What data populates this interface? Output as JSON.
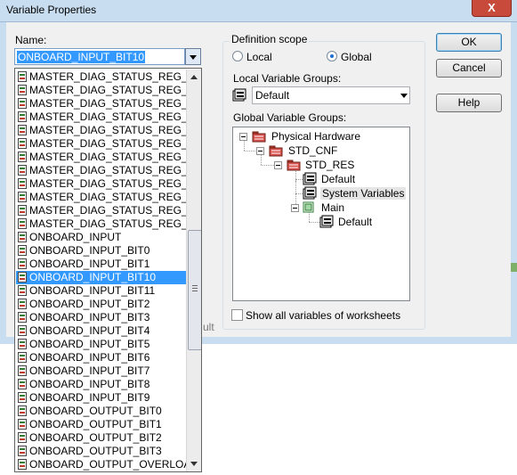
{
  "window": {
    "title": "Variable Properties",
    "close_label": "X"
  },
  "name_field": {
    "label": "Name:",
    "value": "ONBOARD_INPUT_BIT10",
    "options": [
      "MASTER_DIAG_STATUS_REG_HI",
      "MASTER_DIAG_STATUS_REG_LO",
      "MASTER_DIAG_STATUS_REG_PF",
      "MASTER_DIAG_STATUS_REG_QU",
      "MASTER_DIAG_STATUS_REG_RD",
      "MASTER_DIAG_STATUS_REG_RE",
      "MASTER_DIAG_STATUS_REG_RU",
      "MASTER_DIAG_STATUS_REG_SS",
      "MASTER_DIAG_STATUS_REG_SY",
      "MASTER_DIAG_STATUS_REG_SY",
      "MASTER_DIAG_STATUS_REG_US",
      "MASTER_DIAG_STATUS_REG_WA",
      "ONBOARD_INPUT",
      "ONBOARD_INPUT_BIT0",
      "ONBOARD_INPUT_BIT1",
      "ONBOARD_INPUT_BIT10",
      "ONBOARD_INPUT_BIT11",
      "ONBOARD_INPUT_BIT2",
      "ONBOARD_INPUT_BIT3",
      "ONBOARD_INPUT_BIT4",
      "ONBOARD_INPUT_BIT5",
      "ONBOARD_INPUT_BIT6",
      "ONBOARD_INPUT_BIT7",
      "ONBOARD_INPUT_BIT8",
      "ONBOARD_INPUT_BIT9",
      "ONBOARD_OUTPUT_BIT0",
      "ONBOARD_OUTPUT_BIT1",
      "ONBOARD_OUTPUT_BIT2",
      "ONBOARD_OUTPUT_BIT3",
      "ONBOARD_OUTPUT_OVERLOAD_"
    ],
    "selected_index": 15,
    "item_icon": "variable-icon"
  },
  "definition_scope": {
    "label": "Definition scope",
    "local_label": "Local",
    "global_label": "Global",
    "selected": "global"
  },
  "local_groups": {
    "label": "Local Variable Groups:",
    "value": "Default"
  },
  "global_groups": {
    "label": "Global Variable Groups:",
    "tree": {
      "physical_hardware": "Physical Hardware",
      "std_cnf": "STD_CNF",
      "std_res": "STD_RES",
      "default": "Default",
      "system_variables": "System Variables",
      "main": "Main",
      "main_default": "Default"
    },
    "highlighted": "System Variables"
  },
  "show_all_worksheets": {
    "label": "Show all variables of worksheets",
    "checked": false
  },
  "buttons": {
    "ok": "OK",
    "cancel": "Cancel",
    "help": "Help"
  },
  "partial_text": "ult",
  "colors": {
    "selection": "#3399ff",
    "title_bar": "#c9ddf0",
    "folder_red": "#c0392b"
  }
}
